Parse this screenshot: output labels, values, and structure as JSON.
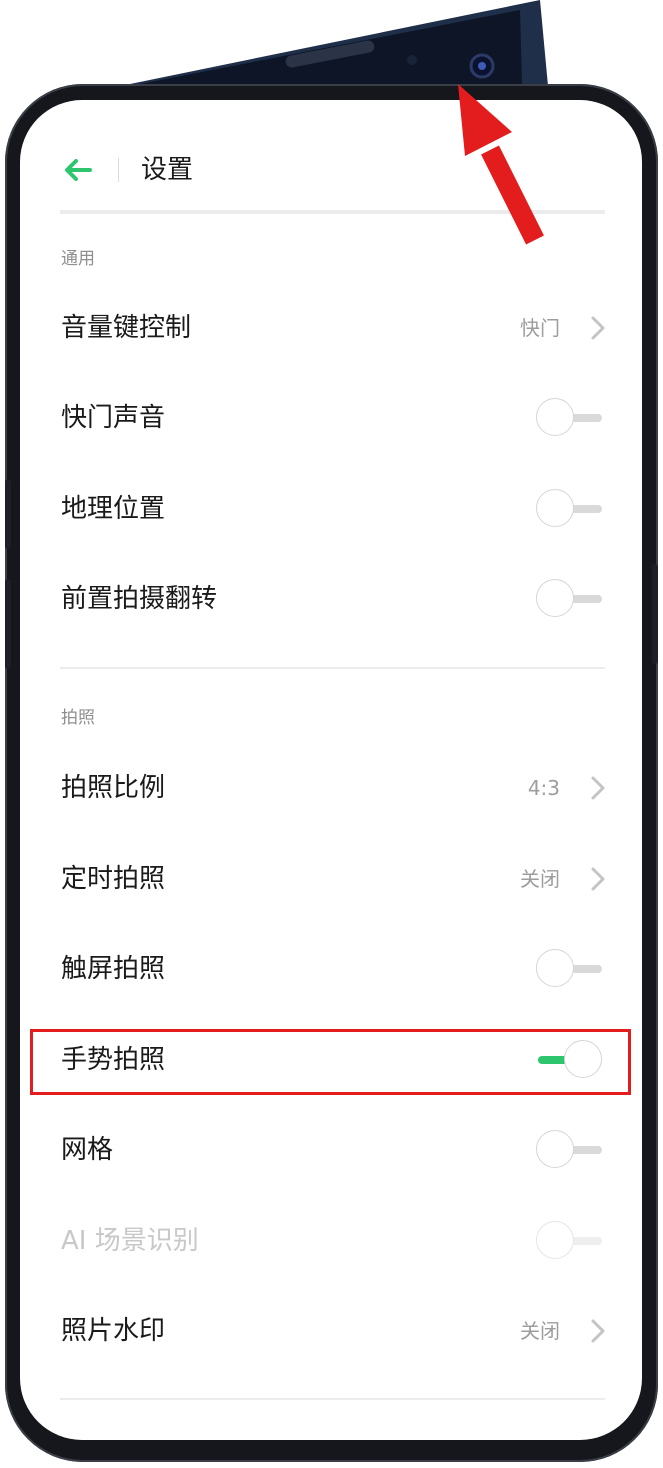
{
  "header": {
    "title": "设置"
  },
  "sections": [
    {
      "title": "通用",
      "rows": [
        {
          "label": "音量键控制",
          "value": "快门",
          "type": "link"
        },
        {
          "label": "快门声音",
          "type": "toggle",
          "state": "off"
        },
        {
          "label": "地理位置",
          "type": "toggle",
          "state": "off"
        },
        {
          "label": "前置拍摄翻转",
          "type": "toggle",
          "state": "off"
        }
      ]
    },
    {
      "title": "拍照",
      "rows": [
        {
          "label": "拍照比例",
          "value": "4:3",
          "type": "link"
        },
        {
          "label": "定时拍照",
          "value": "关闭",
          "type": "link"
        },
        {
          "label": "触屏拍照",
          "type": "toggle",
          "state": "off"
        },
        {
          "label": "手势拍照",
          "type": "toggle",
          "state": "on"
        },
        {
          "label": "网格",
          "type": "toggle",
          "state": "off"
        },
        {
          "label": "AI 场景识别",
          "type": "toggle",
          "state": "off",
          "disabled": true
        },
        {
          "label": "照片水印",
          "value": "关闭",
          "type": "link"
        }
      ]
    }
  ],
  "icons": {
    "back": "back-arrow-icon",
    "chevron": "chevron-right-icon"
  },
  "colors": {
    "accent": "#2dc56e",
    "annotation": "#e31d1d",
    "frame": "#15171c"
  }
}
